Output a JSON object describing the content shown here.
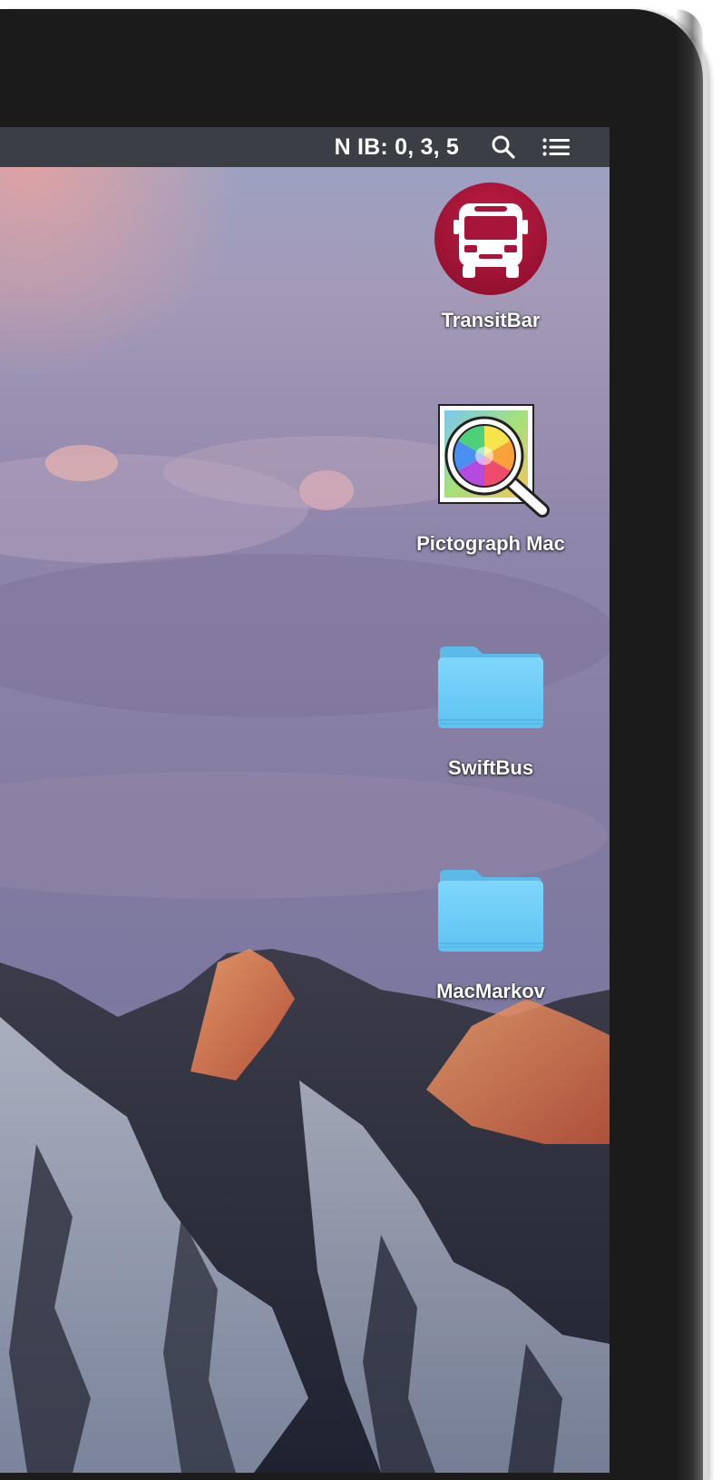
{
  "menubar": {
    "status_text": "N IB: 0, 3, 5",
    "icons": [
      "search-icon",
      "list-icon"
    ]
  },
  "desktop": {
    "icons": [
      {
        "label": "TransitBar",
        "type": "app",
        "icon": "bus-icon"
      },
      {
        "label": "Pictograph Mac",
        "type": "app",
        "icon": "magnifier-color-wheel-icon"
      },
      {
        "label": "SwiftBus",
        "type": "folder",
        "icon": "folder-icon"
      },
      {
        "label": "MacMarkov",
        "type": "folder",
        "icon": "folder-icon"
      }
    ]
  },
  "colors": {
    "menubar_bg": "#3b3f45",
    "bezel": "#1b1b1b",
    "transitbar_red": "#a7153a",
    "folder_blue": "#6ccdf7"
  }
}
